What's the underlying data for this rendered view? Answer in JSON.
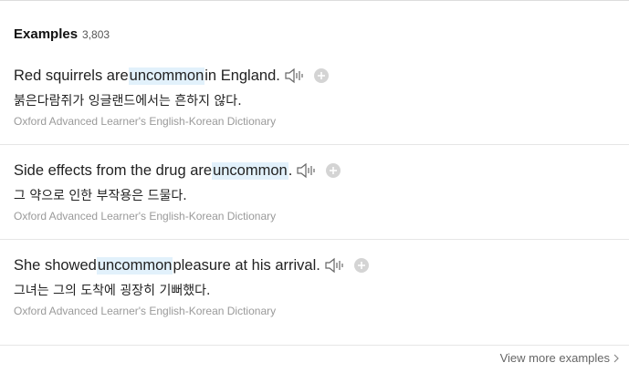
{
  "header": {
    "title": "Examples",
    "count": "3,803"
  },
  "examples": [
    {
      "before": "Red squirrels are ",
      "highlight": "uncommon",
      "after": " in England.",
      "translation": "붉은다람쥐가 잉글랜드에서는 흔하지 않다.",
      "source": "Oxford Advanced Learner's English-Korean Dictionary"
    },
    {
      "before": "Side effects from the drug are ",
      "highlight": "uncommon",
      "after": ".",
      "translation": "그 약으로 인한 부작용은 드물다.",
      "source": "Oxford Advanced Learner's English-Korean Dictionary"
    },
    {
      "before": "She showed ",
      "highlight": "uncommon",
      "after": " pleasure at his arrival.",
      "translation": "그녀는 그의 도착에 굉장히 기뻐했다.",
      "source": "Oxford Advanced Learner's English-Korean Dictionary"
    }
  ],
  "footer": {
    "view_more": "View more examples"
  },
  "colors": {
    "highlight": "#e2f1fb",
    "source_text": "#9a9a9a",
    "divider": "#e6e6e6"
  },
  "icons": {
    "play": "speaker-icon",
    "add": "plus-circle-icon",
    "more": "chevron-right-icon"
  }
}
